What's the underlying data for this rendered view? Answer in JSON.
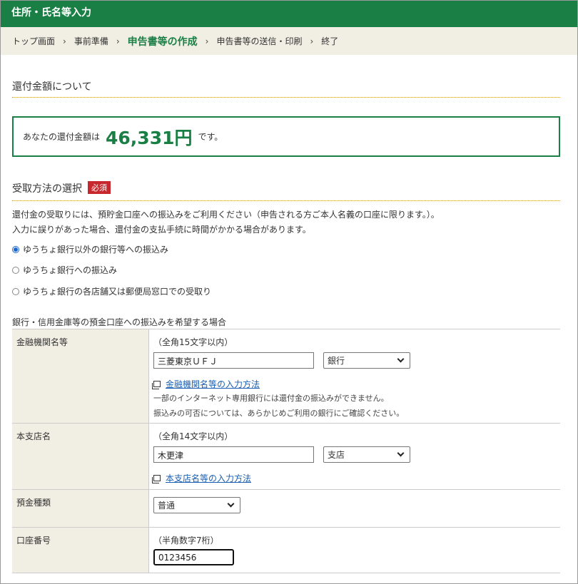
{
  "header": {
    "title": "住所・氏名等入力"
  },
  "breadcrumb": [
    {
      "label": "トップ画面",
      "current": false
    },
    {
      "label": "事前準備",
      "current": false
    },
    {
      "label": "申告書等の作成",
      "current": true
    },
    {
      "label": "申告書等の送信・印刷",
      "current": false
    },
    {
      "label": "終了",
      "current": false
    }
  ],
  "breadcrumb_sep": "›",
  "refund": {
    "section_title": "還付金額について",
    "pre": "あなたの還付金額は",
    "amount": "46,331円",
    "post": "です。"
  },
  "receive": {
    "section_title": "受取方法の選択",
    "required_badge": "必須",
    "desc1": "還付金の受取りには、預貯金口座への振込みをご利用ください（申告される方ご本人名義の口座に限ります。）。",
    "desc2": "入力に誤りがあった場合、還付金の支払手続に時間がかかる場合があります。",
    "options": [
      {
        "label": "ゆうちょ銀行以外の銀行等への振込み",
        "checked": true
      },
      {
        "label": "ゆうちょ銀行への振込み",
        "checked": false
      },
      {
        "label": "ゆうちょ銀行の各店舗又は郵便局窓口での受取り",
        "checked": false
      }
    ]
  },
  "bank_form": {
    "caption": "銀行・信用金庫等の預金口座への振込みを希望する場合",
    "institution": {
      "label": "金融機関名等",
      "hint": "（全角15文字以内）",
      "value": "三菱東京ＵＦＪ",
      "type_value": "銀行",
      "link": "金融機関名等の入力方法",
      "note1": "一部のインターネット専用銀行には還付金の振込みができません。",
      "note2": "振込みの可否については、あらかじめご利用の銀行にご確認ください。"
    },
    "branch": {
      "label": "本支店名",
      "hint": "（全角14文字以内）",
      "value": "木更津",
      "type_value": "支店",
      "link": "本支店名等の入力方法"
    },
    "deposit": {
      "label": "預金種類",
      "value": "普通"
    },
    "account": {
      "label": "口座番号",
      "hint": "（半角数字7桁）",
      "value": "0123456"
    }
  },
  "colors": {
    "brand_green": "#1a7f45",
    "required_red": "#c8272d",
    "link_blue": "#1a5fb4"
  }
}
